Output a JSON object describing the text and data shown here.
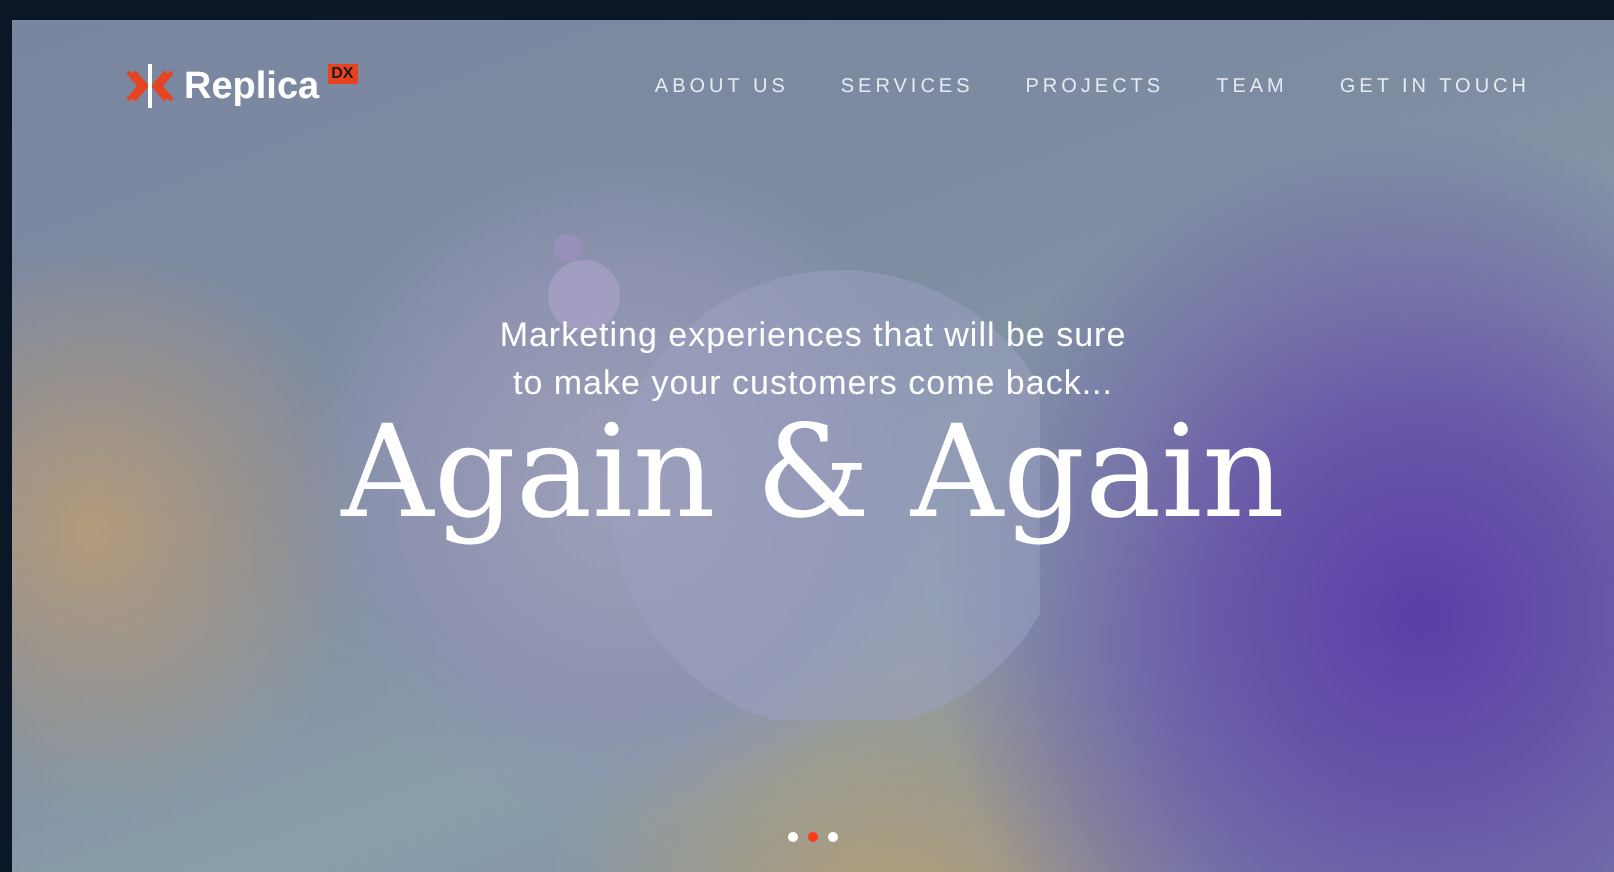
{
  "logo": {
    "name": "Replica",
    "badge": "DX"
  },
  "nav": [
    {
      "label": "ABOUT US"
    },
    {
      "label": "SERVICES"
    },
    {
      "label": "PROJECTS"
    },
    {
      "label": "TEAM"
    },
    {
      "label": "GET IN TOUCH"
    }
  ],
  "hero": {
    "subtitle_lines": [
      "Marketing experiences that will be sure",
      "to make your customers come back..."
    ],
    "headline": "Again & Again"
  },
  "slides": [
    {
      "selected": false
    },
    {
      "selected": true
    },
    {
      "selected": false
    }
  ]
}
